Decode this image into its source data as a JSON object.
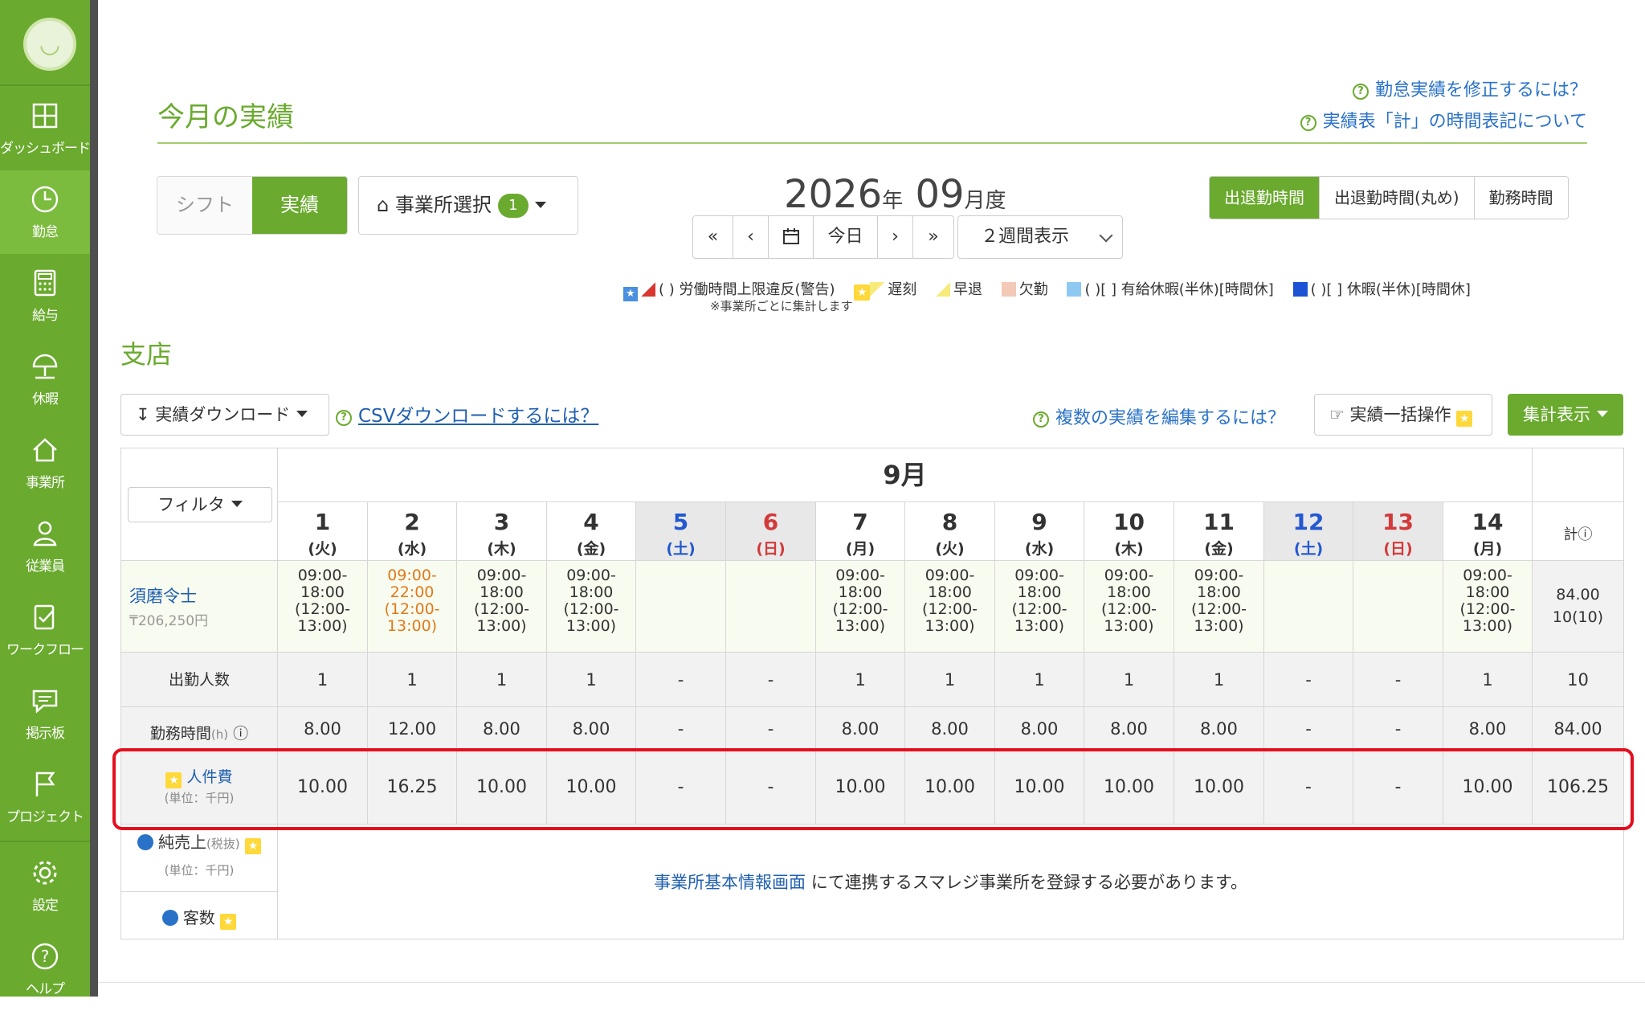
{
  "sidebar": {
    "items": [
      {
        "label": "ダッシュボード",
        "icon": "dashboard-icon"
      },
      {
        "label": "勤怠",
        "icon": "clock-icon"
      },
      {
        "label": "給与",
        "icon": "calculator-icon"
      },
      {
        "label": "休暇",
        "icon": "umbrella-icon"
      },
      {
        "label": "事業所",
        "icon": "home-icon"
      },
      {
        "label": "従業員",
        "icon": "person-icon"
      },
      {
        "label": "ワークフロー",
        "icon": "checklist-icon"
      },
      {
        "label": "掲示板",
        "icon": "message-icon"
      },
      {
        "label": "プロジェクト",
        "icon": "flag-icon"
      },
      {
        "label": "設定",
        "icon": "gear-icon"
      },
      {
        "label": "ヘルプ",
        "icon": "help-icon"
      }
    ],
    "active": "勤怠"
  },
  "header": {
    "title": "今月の実績",
    "help_links": [
      "勤怠実績を修正するには？",
      "実績表「計」の時間表記について"
    ]
  },
  "mode_toggle": {
    "shift": "シフト",
    "actual": "実績"
  },
  "office_select": {
    "label": "事業所選択",
    "count": "1"
  },
  "period": {
    "year": "2026",
    "year_unit": "年",
    "month": "09",
    "month_unit": "月度"
  },
  "period_nav": {
    "first": "«",
    "prev": "‹",
    "calendar": "calendar-icon",
    "today": "今日",
    "next": "›",
    "last": "»"
  },
  "view_select": {
    "value": "２週間表示"
  },
  "time_mode": {
    "options": [
      "出退勤時間",
      "出退勤時間(丸め)",
      "勤務時間"
    ],
    "selected": "出退勤時間"
  },
  "legend": {
    "items": [
      "( ) 労働時間上限違反(警告)",
      "遅刻",
      "早退",
      "欠勤",
      "( )[ ] 有給休暇(半休)[時間休]",
      "( )[ ] 休暇(半休)[時間休]"
    ],
    "note": "※事業所ごとに集計します",
    "colors": {
      "violation": "#d9372f",
      "late": "#f7ea7a",
      "absent": "#f3c9b7",
      "paid_leave": "#8ec9f2",
      "leave": "#1b53d4"
    }
  },
  "branch": {
    "name": "支店"
  },
  "toolbar": {
    "download": "実績ダウンロード",
    "csv_help": "CSVダウンロードするには？",
    "multi_edit_help": "複数の実績を編集するには？",
    "bulk_edit": "実績一括操作",
    "summary": "集計表示"
  },
  "table": {
    "month": "9月",
    "filter": "フィルタ",
    "total_header": "計",
    "days": [
      {
        "day": "1",
        "dow": "(火)",
        "type": "weekday"
      },
      {
        "day": "2",
        "dow": "(水)",
        "type": "weekday"
      },
      {
        "day": "3",
        "dow": "(木)",
        "type": "weekday"
      },
      {
        "day": "4",
        "dow": "(金)",
        "type": "weekday"
      },
      {
        "day": "5",
        "dow": "(土)",
        "type": "sat"
      },
      {
        "day": "6",
        "dow": "(日)",
        "type": "sun"
      },
      {
        "day": "7",
        "dow": "(月)",
        "type": "weekday"
      },
      {
        "day": "8",
        "dow": "(火)",
        "type": "weekday"
      },
      {
        "day": "9",
        "dow": "(水)",
        "type": "weekday"
      },
      {
        "day": "10",
        "dow": "(木)",
        "type": "weekday"
      },
      {
        "day": "11",
        "dow": "(金)",
        "type": "weekday"
      },
      {
        "day": "12",
        "dow": "(土)",
        "type": "sat"
      },
      {
        "day": "13",
        "dow": "(日)",
        "type": "sun"
      },
      {
        "day": "14",
        "dow": "(月)",
        "type": "weekday"
      }
    ],
    "employee": {
      "name": "須磨令士",
      "wage": "₸206,250円",
      "shifts": [
        [
          "09:00-",
          "18:00",
          "(12:00-",
          "13:00)"
        ],
        [
          "09:00-",
          "22:00",
          "(12:00-",
          "13:00)"
        ],
        [
          "09:00-",
          "18:00",
          "(12:00-",
          "13:00)"
        ],
        [
          "09:00-",
          "18:00",
          "(12:00-",
          "13:00)"
        ],
        [],
        [],
        [
          "09:00-",
          "18:00",
          "(12:00-",
          "13:00)"
        ],
        [
          "09:00-",
          "18:00",
          "(12:00-",
          "13:00)"
        ],
        [
          "09:00-",
          "18:00",
          "(12:00-",
          "13:00)"
        ],
        [
          "09:00-",
          "18:00",
          "(12:00-",
          "13:00)"
        ],
        [
          "09:00-",
          "18:00",
          "(12:00-",
          "13:00)"
        ],
        [],
        [],
        [
          "09:00-",
          "18:00",
          "(12:00-",
          "13:00)"
        ]
      ],
      "late_index": 1,
      "total_hours": "84.00",
      "total_days": "10(10)"
    },
    "attendance": {
      "label": "出勤人数",
      "values": [
        "1",
        "1",
        "1",
        "1",
        "-",
        "-",
        "1",
        "1",
        "1",
        "1",
        "1",
        "-",
        "-",
        "1"
      ],
      "total": "10"
    },
    "work_hours": {
      "label": "勤務時間",
      "unit": "(h)",
      "values": [
        "8.00",
        "12.00",
        "8.00",
        "8.00",
        "-",
        "-",
        "8.00",
        "8.00",
        "8.00",
        "8.00",
        "8.00",
        "-",
        "-",
        "8.00"
      ],
      "total": "84.00"
    },
    "labor_cost": {
      "label": "人件費",
      "unit": "(単位：千円)",
      "values": [
        "10.00",
        "16.25",
        "10.00",
        "10.00",
        "-",
        "-",
        "10.00",
        "10.00",
        "10.00",
        "10.00",
        "10.00",
        "-",
        "-",
        "10.00"
      ],
      "total": "106.25"
    },
    "net_sales": {
      "label": "純売上",
      "tax": "(税抜)",
      "unit": "(単位：千円)"
    },
    "customers": {
      "label": "客数"
    },
    "no_sales_link": "事業所基本情報画面",
    "no_sales_text": " にて連携するスマレジ事業所を登録する必要があります。"
  }
}
